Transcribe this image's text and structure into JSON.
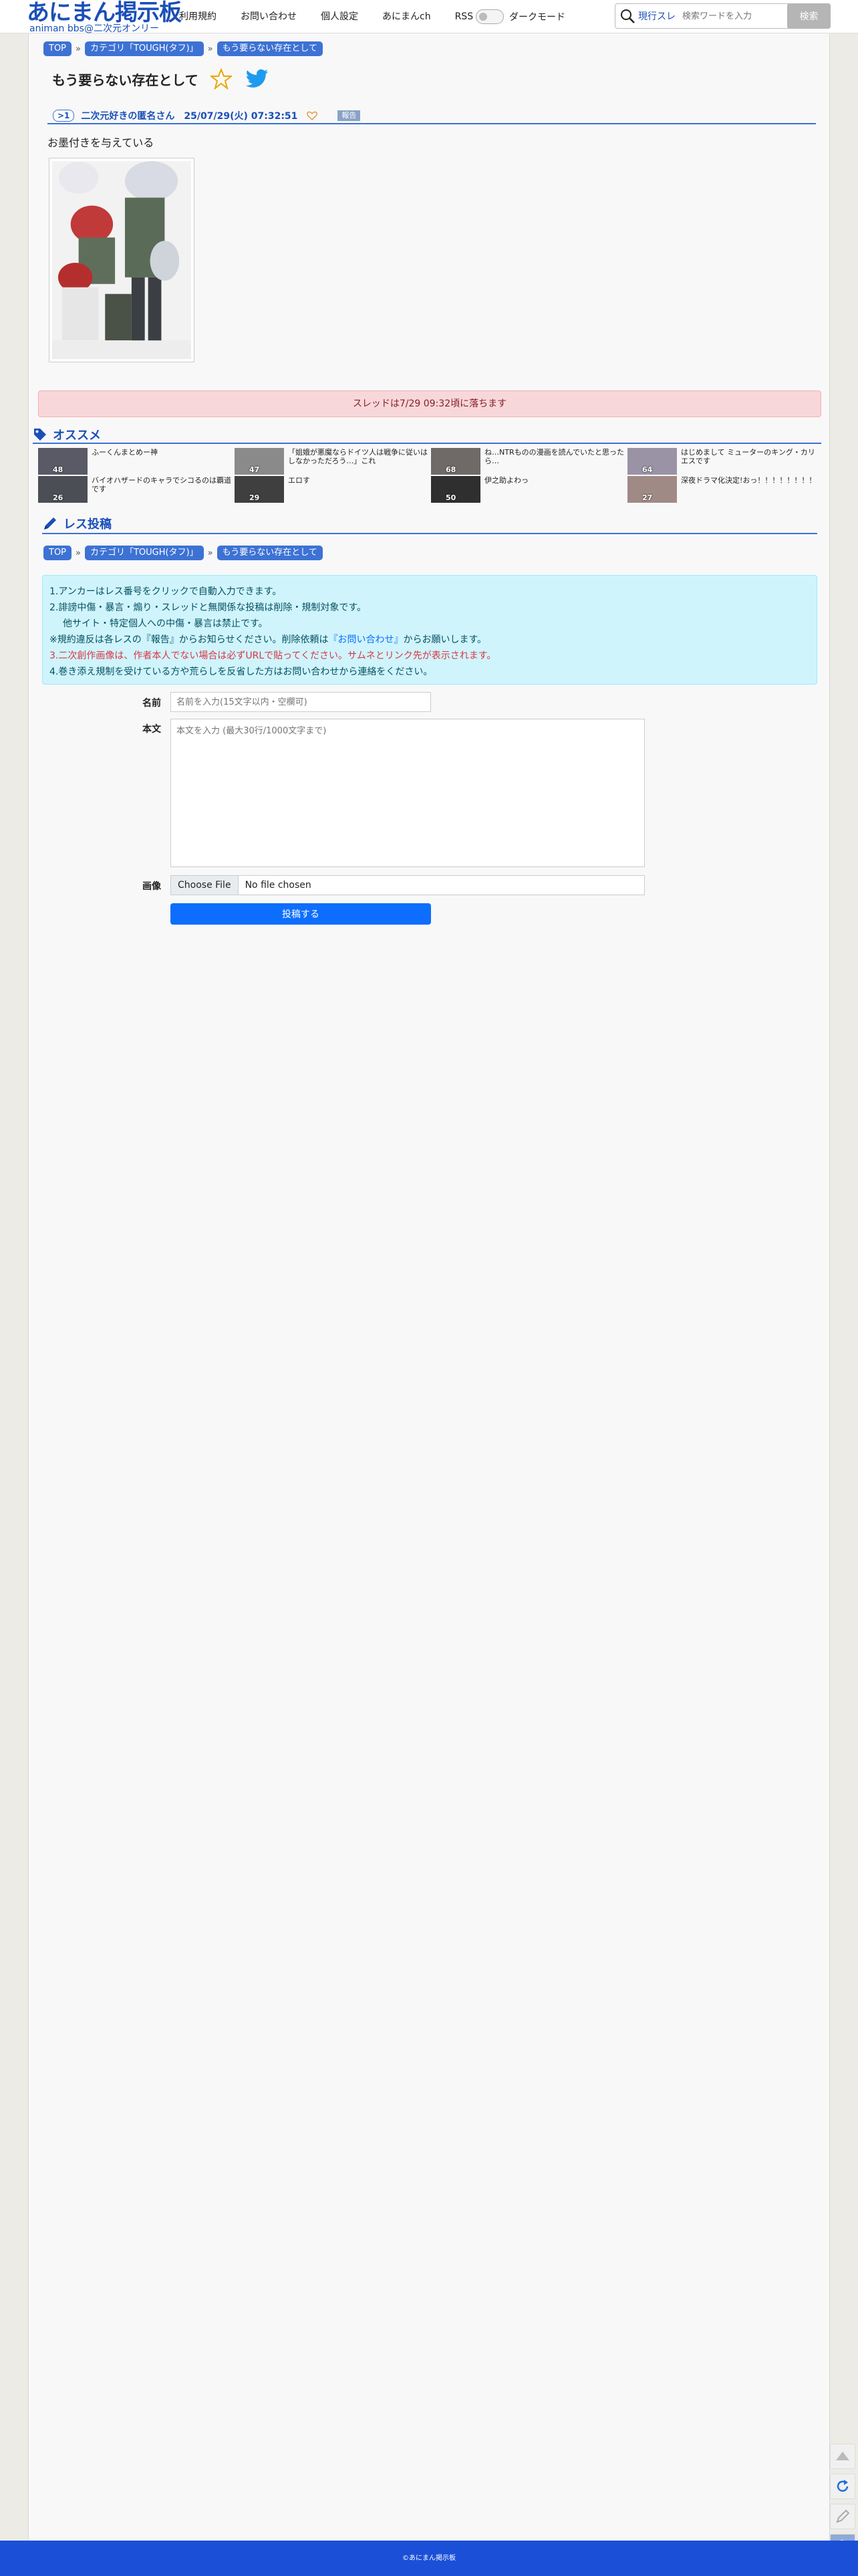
{
  "header": {
    "logo_main": "あにまん掲示板",
    "logo_sub": "animan bbs@二次元オンリー",
    "nav": [
      "利用規約",
      "お問い合わせ",
      "個人設定",
      "あにまんch",
      "RSS"
    ],
    "dark_mode_label": "ダークモード",
    "search_scope": "現行スレ",
    "search_placeholder": "検索ワードを入力",
    "search_button": "検索"
  },
  "breadcrumb": [
    "TOP",
    "カテゴリ「TOUGH(タフ)」",
    "もう要らない存在として"
  ],
  "thread": {
    "title": "もう要らない存在として",
    "post": {
      "number": ">1",
      "name": "二次元好きの匿名さん",
      "date": "25/07/29(火) 07:32:51",
      "report_label": "報告",
      "body": "お墨付きを与えている"
    }
  },
  "notice": "スレッドは7/29 09:32頃に落ちます",
  "recommend": {
    "heading": "オススメ",
    "items": [
      {
        "title": "ふーくんまとめー神",
        "count": "48"
      },
      {
        "title": "「姐娥が悪魔ならドイツ人は戦争に従いはしなかっただろう…」これ",
        "count": "47"
      },
      {
        "title": "ね…NTRものの漫画を読んでいたと思ったら…",
        "count": "68"
      },
      {
        "title": "はじめまして ミューターのキング・カリエスです",
        "count": "64"
      },
      {
        "title": "バイオハザードのキャラでシコるのは覇道です",
        "count": "26"
      },
      {
        "title": "エロす",
        "count": "29"
      },
      {
        "title": "伊之助よわっ",
        "count": "50"
      },
      {
        "title": "深夜ドラマ化決定!おっ！！！！！！！！",
        "count": "27"
      }
    ]
  },
  "reply": {
    "heading": "レス投稿",
    "rules": [
      "1.アンカーはレス番号をクリックで自動入力できます。",
      "2.誹謗中傷・暴言・煽り・スレッドと無関係な投稿は削除・規制対象です。",
      "他サイト・特定個人への中傷・暴言は禁止です。",
      "※規約違反は各レスの『報告』からお知らせください。削除依頼は",
      "『お問い合わせ』",
      "からお願いします。",
      "3.二次創作画像は、作者本人でない場合は必ずURLで貼ってください。サムネとリンク先が表示されます。",
      "4.巻き添え規制を受けている方や荒らしを反省した方はお問い合わせから連絡をください。"
    ],
    "name_label": "名前",
    "name_placeholder": "名前を入力(15文字以内・空欄可)",
    "body_label": "本文",
    "body_placeholder": "本文を入力 (最大30行/1000文字まで)",
    "image_label": "画像",
    "file_button": "Choose File",
    "file_text": "No file chosen",
    "submit_label": "投稿する"
  },
  "footer": "©あにまん掲示板",
  "colors": {
    "brand": "#1b4fb8",
    "accent": "#3d72d4",
    "notice_bg": "#f8d7da",
    "info_bg": "#cff4fc",
    "footer_bg": "#1b4fd8"
  }
}
